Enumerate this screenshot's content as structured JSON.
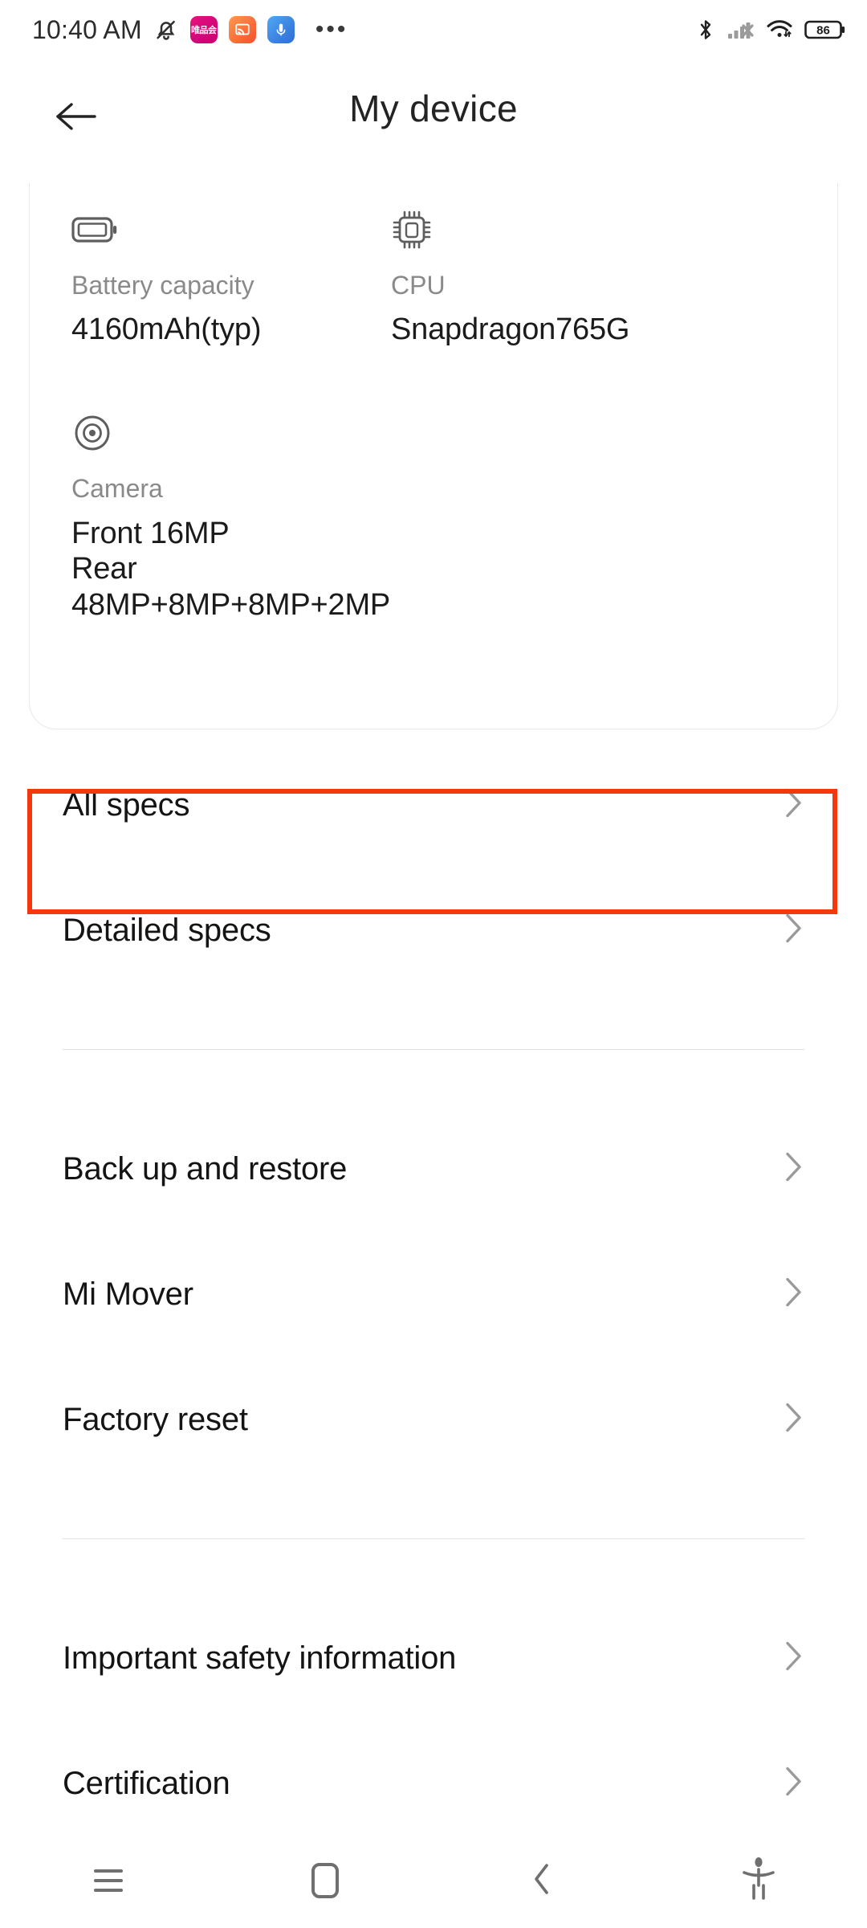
{
  "status_bar": {
    "time": "10:40 AM",
    "icons_left": [
      {
        "name": "bell-muted-icon"
      },
      {
        "name": "app-notification-vipshop-icon",
        "text": "唯品会",
        "color": "#d4067a"
      },
      {
        "name": "app-notification-cast-icon",
        "color": "#fb6b3a"
      },
      {
        "name": "app-notification-recorder-icon",
        "color": "#3b82e0"
      }
    ],
    "overflow": "•••",
    "icons_right": [
      {
        "name": "bluetooth-icon"
      },
      {
        "name": "signal-no-sim-icon"
      },
      {
        "name": "wifi-icon"
      },
      {
        "name": "battery-icon"
      }
    ],
    "battery_level": "86"
  },
  "header": {
    "title": "My device",
    "back_label": "Back"
  },
  "spec_card": {
    "items": [
      {
        "icon": "battery-capacity-icon",
        "label": "Battery capacity",
        "value": "4160mAh(typ)"
      },
      {
        "icon": "cpu-chip-icon",
        "label": "CPU",
        "value": "Snapdragon765G"
      },
      {
        "icon": "camera-lens-icon",
        "label": "Camera",
        "value": "Front 16MP",
        "value2": "Rear 48MP+8MP+8MP+2MP"
      }
    ]
  },
  "list": {
    "groups": [
      {
        "rows": [
          {
            "label": "All specs",
            "highlighted": true
          },
          {
            "label": "Detailed specs",
            "highlighted": false
          }
        ]
      },
      {
        "rows": [
          {
            "label": "Back up and restore",
            "highlighted": false
          },
          {
            "label": "Mi Mover",
            "highlighted": false
          },
          {
            "label": "Factory reset",
            "highlighted": false
          }
        ]
      },
      {
        "rows": [
          {
            "label": "Important safety information",
            "highlighted": false
          },
          {
            "label": "Certification",
            "highlighted": false
          }
        ]
      }
    ]
  },
  "highlight": {
    "target": "All specs",
    "color": "#F4370D"
  },
  "nav_bar": {
    "buttons": [
      {
        "name": "recents-button",
        "icon": "hamburger-icon"
      },
      {
        "name": "home-button",
        "icon": "rounded-square-icon"
      },
      {
        "name": "back-button",
        "icon": "chevron-left-icon"
      },
      {
        "name": "accessibility-button",
        "icon": "accessibility-person-icon"
      }
    ]
  }
}
